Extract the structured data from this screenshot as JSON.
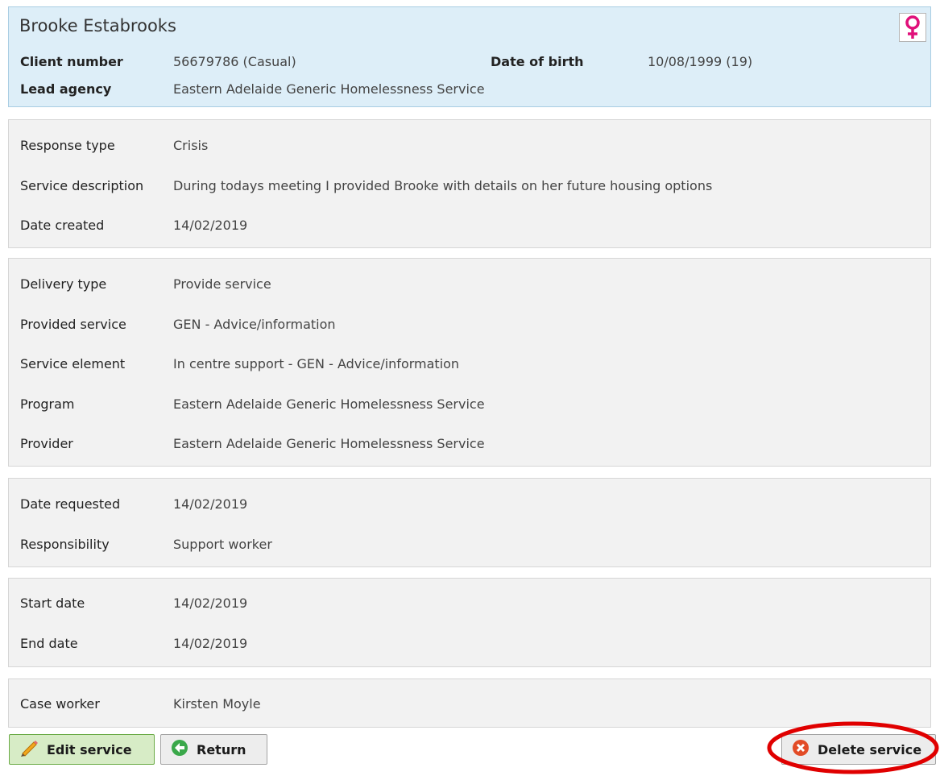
{
  "client": {
    "name": "Brooke Estabrooks",
    "client_number_label": "Client number",
    "client_number": "56679786 (Casual)",
    "dob_label": "Date of birth",
    "dob": "10/08/1999 (19)",
    "lead_agency_label": "Lead agency",
    "lead_agency": "Eastern Adelaide Generic Homelessness Service",
    "gender_icon": "female-icon"
  },
  "service": {
    "response_type_label": "Response type",
    "response_type": "Crisis",
    "description_label": "Service description",
    "description": "During todays meeting I provided Brooke with details on her future housing options",
    "date_created_label": "Date created",
    "date_created": "14/02/2019",
    "delivery_type_label": "Delivery type",
    "delivery_type": "Provide service",
    "provided_service_label": "Provided service",
    "provided_service": "GEN - Advice/information",
    "service_element_label": "Service element",
    "service_element": "In centre support - GEN - Advice/information",
    "program_label": "Program",
    "program": "Eastern Adelaide Generic Homelessness Service",
    "provider_label": "Provider",
    "provider": "Eastern Adelaide Generic Homelessness Service",
    "date_requested_label": "Date requested",
    "date_requested": "14/02/2019",
    "responsibility_label": "Responsibility",
    "responsibility": "Support worker",
    "start_date_label": "Start date",
    "start_date": "14/02/2019",
    "end_date_label": "End date",
    "end_date": "14/02/2019",
    "case_worker_label": "Case worker",
    "case_worker": "Kirsten Moyle"
  },
  "actions": {
    "edit_label": "Edit service",
    "return_label": "Return",
    "delete_label": "Delete service"
  },
  "colors": {
    "header_bg": "#ddeef8",
    "panel_bg": "#f2f2f2",
    "edit_btn_bg": "#d7ecc6",
    "female_icon": "#e0107a",
    "annotation_ring": "#e00000"
  }
}
